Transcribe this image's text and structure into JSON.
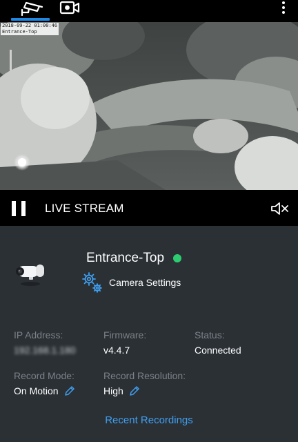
{
  "top_bar": {
    "tabs": [
      {
        "icon": "cctv-icon",
        "active": true
      },
      {
        "icon": "video-camera-icon",
        "active": false
      }
    ],
    "menu_icon": "more-vertical-icon",
    "accent_color": "#1e88e5"
  },
  "video": {
    "timestamp": "2018-09-22 01:00:46",
    "camera_label": "Entrance-Top"
  },
  "controls": {
    "pause_icon": "pause-icon",
    "label": "LIVE STREAM",
    "mute_icon": "volume-muted-icon"
  },
  "camera": {
    "name": "Entrance-Top",
    "status_color": "#2ecc71",
    "settings_label": "Camera Settings"
  },
  "info": {
    "ip_label": "IP Address:",
    "ip_value": "192.168.1.180",
    "firmware_label": "Firmware:",
    "firmware_value": "v4.4.7",
    "status_label": "Status:",
    "status_value": "Connected",
    "record_mode_label": "Record Mode:",
    "record_mode_value": "On Motion",
    "record_resolution_label": "Record Resolution:",
    "record_resolution_value": "High"
  },
  "recent_recordings_label": "Recent Recordings"
}
